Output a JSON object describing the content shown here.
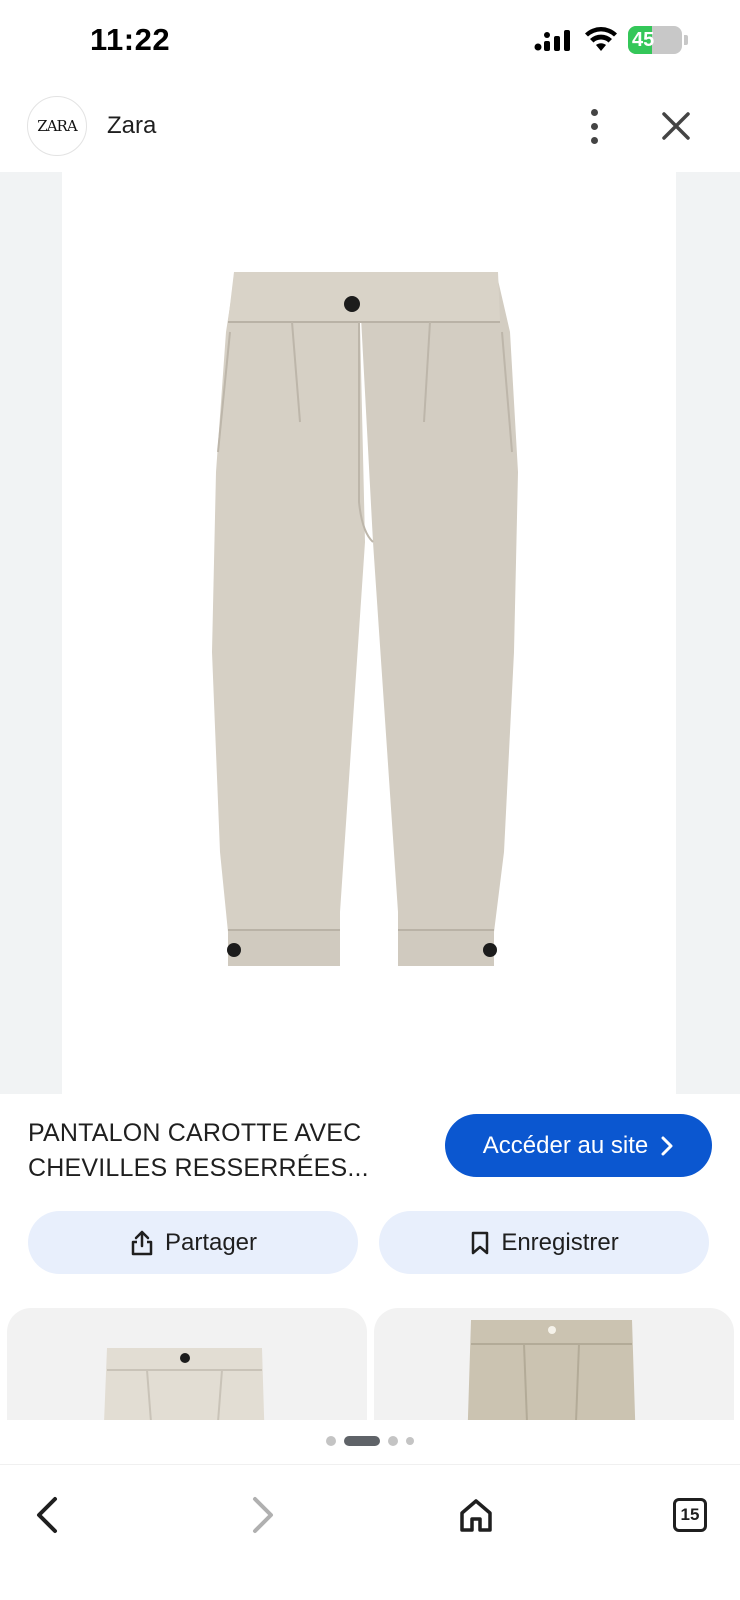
{
  "status_bar": {
    "time": "11:22",
    "battery_level": "45",
    "battery_percent": 45,
    "icons": [
      "signal-icon",
      "wifi-icon",
      "battery-icon"
    ]
  },
  "header": {
    "logo_text": "ZARA",
    "site_name": "Zara",
    "icons": [
      "more-vert-icon",
      "close-icon"
    ]
  },
  "product": {
    "title": "PANTALON CAROTTE AVEC CHEVILLES RESSERRÉES...",
    "visit_label": "Accéder au site",
    "image_alt": "pantalon beige"
  },
  "actions": {
    "share_label": "Partager",
    "save_label": "Enregistrer"
  },
  "carousel": {
    "dot_count": 4,
    "active_index": 1
  },
  "bottom_nav": {
    "tab_count": "15",
    "icons": [
      "back-icon",
      "forward-icon",
      "home-icon",
      "tabs-icon"
    ]
  },
  "colors": {
    "accent": "#0b57d0",
    "action_bg": "#e8effc",
    "pants": "#d6d0c5"
  }
}
